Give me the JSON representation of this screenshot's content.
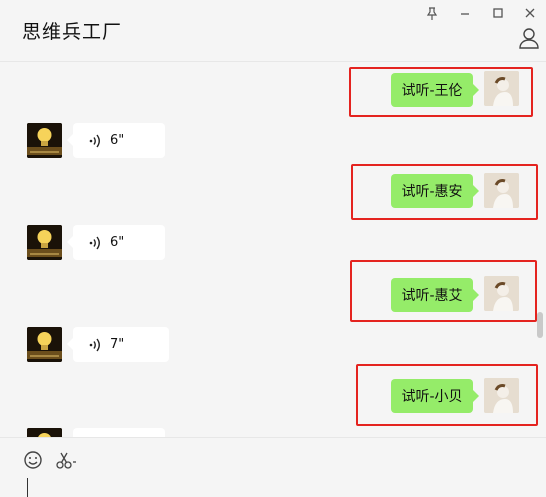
{
  "window": {
    "title": "思维兵工厂"
  },
  "messages": [
    {
      "side": "right",
      "text": "试听-王伦"
    },
    {
      "side": "left",
      "type": "voice",
      "duration": "6\""
    },
    {
      "side": "right",
      "text": "试听-惠安"
    },
    {
      "side": "left",
      "type": "voice",
      "duration": "6\""
    },
    {
      "side": "right",
      "text": "试听-惠艾"
    },
    {
      "side": "left",
      "type": "voice",
      "duration": "7\""
    },
    {
      "side": "right",
      "text": "试听-小贝"
    }
  ],
  "colors": {
    "sent_bubble": "#95ec69",
    "highlight_box": "#e4231f",
    "background": "#f5f5f5"
  }
}
